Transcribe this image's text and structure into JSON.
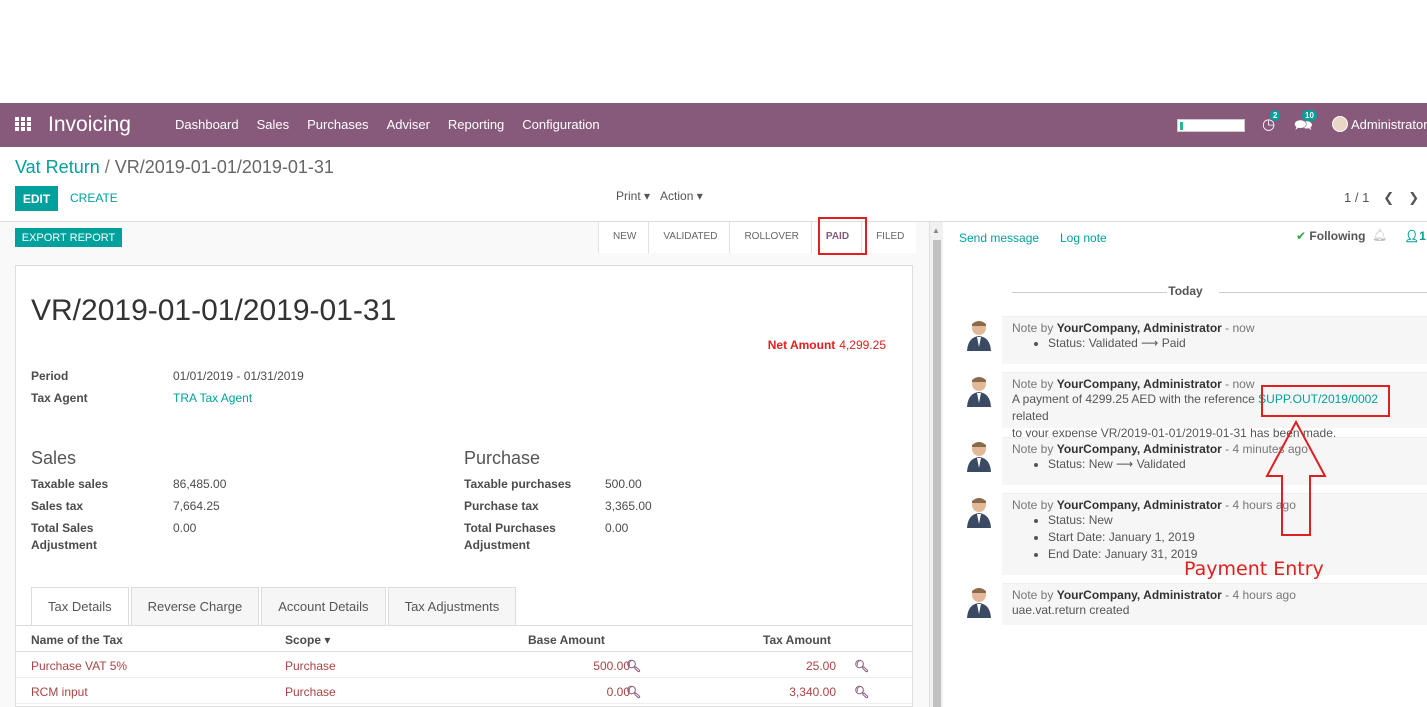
{
  "nav": {
    "brand": "Invoicing",
    "menu": [
      "Dashboard",
      "Sales",
      "Purchases",
      "Adviser",
      "Reporting",
      "Configuration"
    ],
    "activity_count": "2",
    "message_count": "10",
    "user": "Administrator"
  },
  "breadcrumb": {
    "parent": "Vat Return",
    "separator": "/",
    "current": "VR/2019-01-01/2019-01-31"
  },
  "buttons": {
    "edit": "EDIT",
    "create": "CREATE",
    "print": "Print",
    "action": "Action",
    "export": "EXPORT REPORT"
  },
  "pager": {
    "value": "1 / 1"
  },
  "stages": [
    "NEW",
    "VALIDATED",
    "ROLLOVER",
    "PAID",
    "FILED"
  ],
  "record": {
    "title": "VR/2019-01-01/2019-01-31",
    "net_label": "Net Amount",
    "net_value": "4,299.25",
    "period_label": "Period",
    "period_value": "01/01/2019 - 01/31/2019",
    "agent_label": "Tax Agent",
    "agent_value": "TRA Tax Agent"
  },
  "sales": {
    "heading": "Sales",
    "taxable_label": "Taxable sales",
    "taxable_value": "86,485.00",
    "tax_label": "Sales tax",
    "tax_value": "7,664.25",
    "adj_label_1": "Total Sales",
    "adj_label_2": "Adjustment",
    "adj_value": "0.00"
  },
  "purchase": {
    "heading": "Purchase",
    "taxable_label": "Taxable purchases",
    "taxable_value": "500.00",
    "tax_label": "Purchase tax",
    "tax_value": "3,365.00",
    "adj_label_1": "Total Purchases",
    "adj_label_2": "Adjustment",
    "adj_value": "0.00"
  },
  "tabs": [
    "Tax Details",
    "Reverse Charge",
    "Account Details",
    "Tax Adjustments"
  ],
  "table": {
    "headers": {
      "name": "Name of the Tax",
      "scope": "Scope",
      "base": "Base Amount",
      "tax": "Tax Amount"
    },
    "rows": [
      {
        "name": "Purchase VAT 5%",
        "scope": "Purchase",
        "base": "500.00",
        "tax": "25.00"
      },
      {
        "name": "RCM input",
        "scope": "Purchase",
        "base": "0.00",
        "tax": "3,340.00"
      }
    ]
  },
  "chatter": {
    "send_message": "Send message",
    "log_note": "Log note",
    "following": "Following",
    "followers": "1",
    "today": "Today",
    "messages": [
      {
        "prefix": "Note by",
        "author": "YourCompany, Administrator",
        "time": "- now",
        "items": [
          "Status: Validated ⟶ Paid"
        ]
      },
      {
        "prefix": "Note by",
        "author": "YourCompany, Administrator",
        "time": "- now",
        "body_pre": "A payment of 4299.25 AED with the reference ",
        "ref": "SUPP.OUT/2019/0002",
        "body_post": " related",
        "body_line2": "to your expense VR/2019-01-01/2019-01-31 has been made."
      },
      {
        "prefix": "Note by",
        "author": "YourCompany, Administrator",
        "time": "- 4 minutes ago",
        "items": [
          "Status: New ⟶ Validated"
        ]
      },
      {
        "prefix": "Note by",
        "author": "YourCompany, Administrator",
        "time": "- 4 hours ago",
        "items": [
          "Status: New",
          "Start Date: January 1, 2019",
          "End Date: January 31, 2019"
        ]
      },
      {
        "prefix": "Note by",
        "author": "YourCompany, Administrator",
        "time": "- 4 hours ago",
        "body_line2": "uae.vat.return created"
      }
    ]
  },
  "annotation": {
    "label": "Payment Entry",
    "color": "#e02020"
  },
  "colors": {
    "brand": "#875a7b",
    "accent": "#00a09d"
  }
}
